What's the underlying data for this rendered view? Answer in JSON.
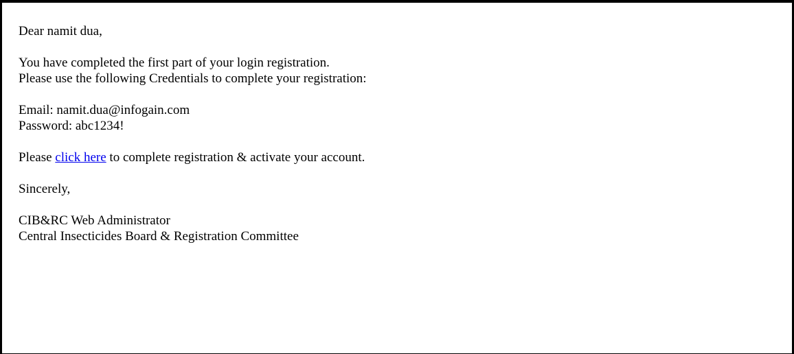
{
  "email": {
    "greeting": "Dear namit dua,",
    "intro_line_1": "You have completed the first part of your login registration.",
    "intro_line_2": "Please use the following Credentials to complete your registration:",
    "credentials": {
      "email_label": "Email: ",
      "email_value": "namit.dua@infogain.com",
      "password_label": "Password: ",
      "password_value": "abc1234!"
    },
    "activation": {
      "prefix": "Please ",
      "link_text": "click here",
      "suffix": " to complete registration & activate your account."
    },
    "closing": "Sincerely,",
    "signature_line_1": "CIB&RC Web Administrator",
    "signature_line_2": "Central Insecticides Board & Registration Committee"
  },
  "colors": {
    "link": "#0000ee",
    "border": "#000000",
    "text": "#000000",
    "background": "#ffffff"
  }
}
